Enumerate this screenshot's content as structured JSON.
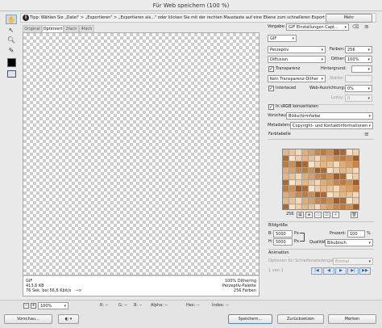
{
  "window": {
    "title": "Für Web speichern (100 %)"
  },
  "tip": {
    "text": "Tipp: Wählen Sie „Datei\" > „Exportieren\" > „Exportieren als...\" oder klicken Sie mit der rechten Maustaste auf eine Ebene zum schnelleren Export von Elementen",
    "more_button": "Mehr"
  },
  "tabs": [
    "Original",
    "Optimiert",
    "2fach",
    "4fach"
  ],
  "preview": {
    "format": "GIF",
    "size": "413,6 KB",
    "download_time": "76 Sek. bei 56,6 Kbit/s",
    "menu_glyph": "→≡",
    "dithering": "100% Dithering",
    "palette": "Perzeptiv-Palette",
    "colors": "256 Farben"
  },
  "settings": {
    "preset_label": "Vorgabe:",
    "preset_value": "GIF Einstellungen Capt...",
    "format_value": "GIF",
    "reduction_value": "Perzeptiv",
    "colors_label": "Farben:",
    "colors_value": "256",
    "dither_algo": "Diffusion",
    "dither_label": "Dither:",
    "dither_value": "100%",
    "transparency_label": "Transparenz",
    "transparency_checked": true,
    "matte_label": "Hintergrund:",
    "transparency_dither": "Kein Transparenz-Dither",
    "amount_label": "Stärke:",
    "interlaced_label": "Interlaced",
    "interlaced_checked": true,
    "websnap_label": "Web-Ausrichtung:",
    "websnap_value": "0%",
    "lossy_label": "Lossy:",
    "lossy_value": "0",
    "srgb_label": "In sRGB konvertieren",
    "srgb_checked": true,
    "preview_label": "Vorschau:",
    "preview_value": "Bildschirmfarbe",
    "metadata_label": "Metadaten:",
    "metadata_value": "Copyright- und Kontaktinformationen"
  },
  "color_table": {
    "label": "Farbtabelle",
    "count": "256",
    "swatches": [
      "#e3b78a",
      "#c98f55",
      "#f2d9bc",
      "#a86a36",
      "#d7a06a",
      "#efcfa8",
      "#b87c45",
      "#e8c299",
      "#9c5e2e",
      "#dcae7e",
      "#f6e3cc",
      "#c2884f"
    ]
  },
  "image_size": {
    "label": "Bildgröße",
    "width_label": "B:",
    "width_value": "5000",
    "height_label": "H:",
    "height_value": "5000",
    "unit": "Px",
    "percent_label": "Prozent:",
    "percent_value": "100",
    "percent_unit": "%",
    "quality_label": "Qualität:",
    "quality_value": "Bikubisch"
  },
  "animation": {
    "label": "Animation",
    "loop_label": "Optionen für Schleifenwiedergabe:",
    "loop_value": "Einmal",
    "frame_text": "1 von 1"
  },
  "status": {
    "zoom": "100%",
    "r_label": "R:",
    "r_value": "--",
    "g_label": "G:",
    "g_value": "--",
    "b_label": "B:",
    "b_value": "--",
    "alpha_label": "Alpha:",
    "alpha_value": "--",
    "hex_label": "Hex:",
    "hex_value": "--",
    "index_label": "Index:",
    "index_value": "--"
  },
  "buttons": {
    "preview": "Vorschau...",
    "save": "Speichern...",
    "reset": "Zurücksetzen",
    "remember": "Merken"
  }
}
